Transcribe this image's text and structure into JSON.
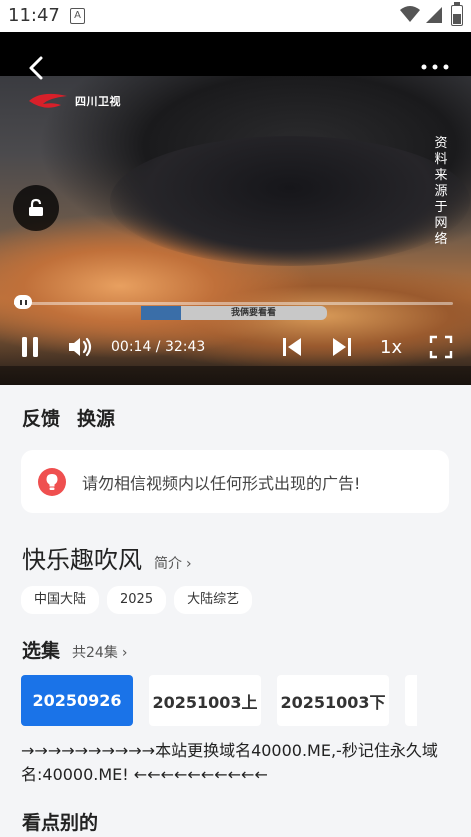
{
  "status_bar": {
    "time": "11:47",
    "notification_icon": "A"
  },
  "player": {
    "channel_logo_text": "四川卫视",
    "side_text": "资料来源于网络",
    "caption_text": "我俩要看看",
    "current_time": "00:14",
    "separator": " / ",
    "duration": "32:43",
    "speed": "1x",
    "progress": 0.0071
  },
  "actions": {
    "feedback": "反馈",
    "switch_source": "换源"
  },
  "notice": {
    "text": "请勿相信视频内以任何形式出现的广告!"
  },
  "show": {
    "title": "快乐趣吹风",
    "intro_link": "简介",
    "tags": [
      "中国大陆",
      "2025",
      "大陆综艺"
    ]
  },
  "episodes": {
    "title": "选集",
    "count": "共24集",
    "items": [
      {
        "label": "20250926",
        "active": true
      },
      {
        "label": "20251003上",
        "active": false
      },
      {
        "label": "20251003下",
        "active": false
      }
    ]
  },
  "marquee_text": "→→→→→→→→→→本站更换域名40000.ME,-秒记住永久域名:40000.ME! ←←←←←←←←←←",
  "recommend_title": "看点别的",
  "colors": {
    "accent": "#1a73e8",
    "notice_icon": "#ef4f4f"
  }
}
